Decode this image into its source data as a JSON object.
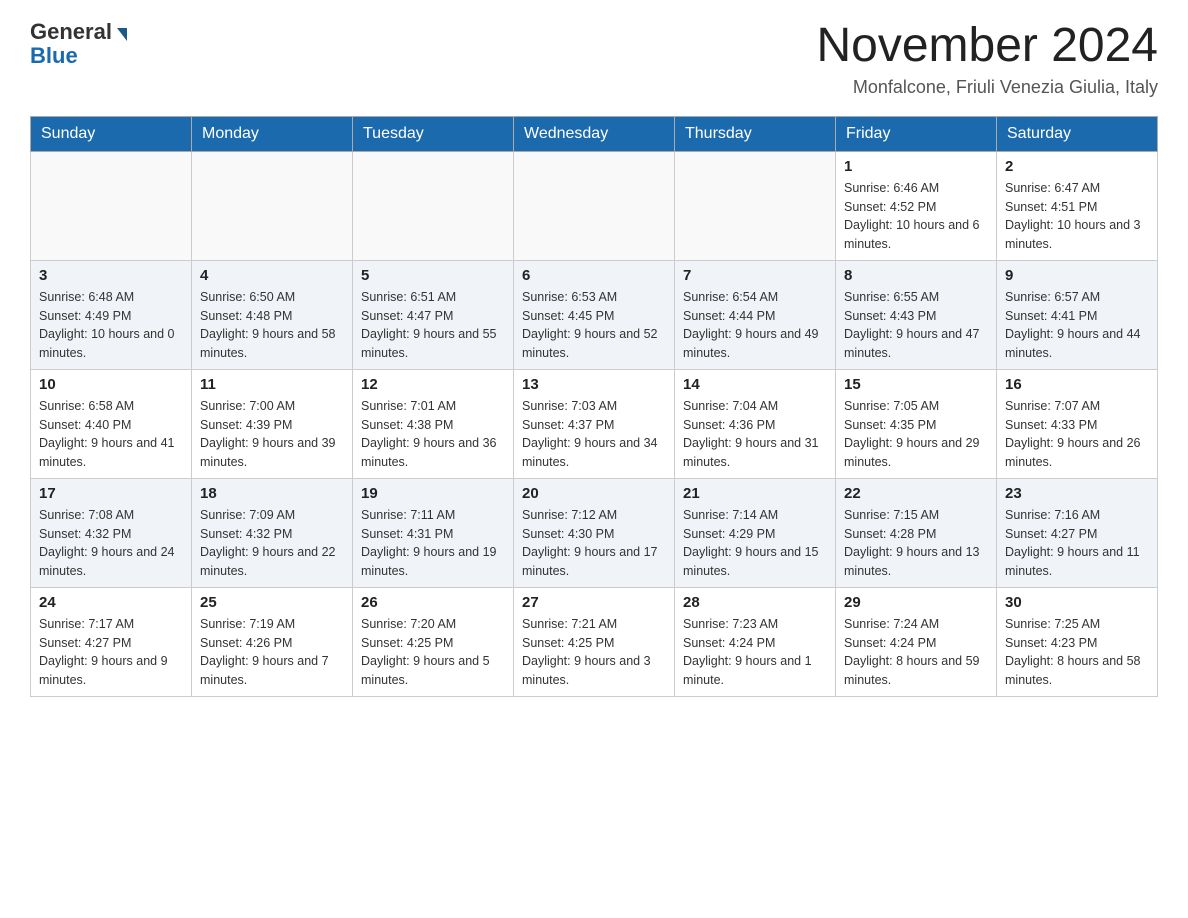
{
  "header": {
    "logo_general": "General",
    "logo_blue": "Blue",
    "month_title": "November 2024",
    "location": "Monfalcone, Friuli Venezia Giulia, Italy"
  },
  "weekdays": [
    "Sunday",
    "Monday",
    "Tuesday",
    "Wednesday",
    "Thursday",
    "Friday",
    "Saturday"
  ],
  "weeks": [
    [
      {
        "day": "",
        "info": ""
      },
      {
        "day": "",
        "info": ""
      },
      {
        "day": "",
        "info": ""
      },
      {
        "day": "",
        "info": ""
      },
      {
        "day": "",
        "info": ""
      },
      {
        "day": "1",
        "info": "Sunrise: 6:46 AM\nSunset: 4:52 PM\nDaylight: 10 hours and 6 minutes."
      },
      {
        "day": "2",
        "info": "Sunrise: 6:47 AM\nSunset: 4:51 PM\nDaylight: 10 hours and 3 minutes."
      }
    ],
    [
      {
        "day": "3",
        "info": "Sunrise: 6:48 AM\nSunset: 4:49 PM\nDaylight: 10 hours and 0 minutes."
      },
      {
        "day": "4",
        "info": "Sunrise: 6:50 AM\nSunset: 4:48 PM\nDaylight: 9 hours and 58 minutes."
      },
      {
        "day": "5",
        "info": "Sunrise: 6:51 AM\nSunset: 4:47 PM\nDaylight: 9 hours and 55 minutes."
      },
      {
        "day": "6",
        "info": "Sunrise: 6:53 AM\nSunset: 4:45 PM\nDaylight: 9 hours and 52 minutes."
      },
      {
        "day": "7",
        "info": "Sunrise: 6:54 AM\nSunset: 4:44 PM\nDaylight: 9 hours and 49 minutes."
      },
      {
        "day": "8",
        "info": "Sunrise: 6:55 AM\nSunset: 4:43 PM\nDaylight: 9 hours and 47 minutes."
      },
      {
        "day": "9",
        "info": "Sunrise: 6:57 AM\nSunset: 4:41 PM\nDaylight: 9 hours and 44 minutes."
      }
    ],
    [
      {
        "day": "10",
        "info": "Sunrise: 6:58 AM\nSunset: 4:40 PM\nDaylight: 9 hours and 41 minutes."
      },
      {
        "day": "11",
        "info": "Sunrise: 7:00 AM\nSunset: 4:39 PM\nDaylight: 9 hours and 39 minutes."
      },
      {
        "day": "12",
        "info": "Sunrise: 7:01 AM\nSunset: 4:38 PM\nDaylight: 9 hours and 36 minutes."
      },
      {
        "day": "13",
        "info": "Sunrise: 7:03 AM\nSunset: 4:37 PM\nDaylight: 9 hours and 34 minutes."
      },
      {
        "day": "14",
        "info": "Sunrise: 7:04 AM\nSunset: 4:36 PM\nDaylight: 9 hours and 31 minutes."
      },
      {
        "day": "15",
        "info": "Sunrise: 7:05 AM\nSunset: 4:35 PM\nDaylight: 9 hours and 29 minutes."
      },
      {
        "day": "16",
        "info": "Sunrise: 7:07 AM\nSunset: 4:33 PM\nDaylight: 9 hours and 26 minutes."
      }
    ],
    [
      {
        "day": "17",
        "info": "Sunrise: 7:08 AM\nSunset: 4:32 PM\nDaylight: 9 hours and 24 minutes."
      },
      {
        "day": "18",
        "info": "Sunrise: 7:09 AM\nSunset: 4:32 PM\nDaylight: 9 hours and 22 minutes."
      },
      {
        "day": "19",
        "info": "Sunrise: 7:11 AM\nSunset: 4:31 PM\nDaylight: 9 hours and 19 minutes."
      },
      {
        "day": "20",
        "info": "Sunrise: 7:12 AM\nSunset: 4:30 PM\nDaylight: 9 hours and 17 minutes."
      },
      {
        "day": "21",
        "info": "Sunrise: 7:14 AM\nSunset: 4:29 PM\nDaylight: 9 hours and 15 minutes."
      },
      {
        "day": "22",
        "info": "Sunrise: 7:15 AM\nSunset: 4:28 PM\nDaylight: 9 hours and 13 minutes."
      },
      {
        "day": "23",
        "info": "Sunrise: 7:16 AM\nSunset: 4:27 PM\nDaylight: 9 hours and 11 minutes."
      }
    ],
    [
      {
        "day": "24",
        "info": "Sunrise: 7:17 AM\nSunset: 4:27 PM\nDaylight: 9 hours and 9 minutes."
      },
      {
        "day": "25",
        "info": "Sunrise: 7:19 AM\nSunset: 4:26 PM\nDaylight: 9 hours and 7 minutes."
      },
      {
        "day": "26",
        "info": "Sunrise: 7:20 AM\nSunset: 4:25 PM\nDaylight: 9 hours and 5 minutes."
      },
      {
        "day": "27",
        "info": "Sunrise: 7:21 AM\nSunset: 4:25 PM\nDaylight: 9 hours and 3 minutes."
      },
      {
        "day": "28",
        "info": "Sunrise: 7:23 AM\nSunset: 4:24 PM\nDaylight: 9 hours and 1 minute."
      },
      {
        "day": "29",
        "info": "Sunrise: 7:24 AM\nSunset: 4:24 PM\nDaylight: 8 hours and 59 minutes."
      },
      {
        "day": "30",
        "info": "Sunrise: 7:25 AM\nSunset: 4:23 PM\nDaylight: 8 hours and 58 minutes."
      }
    ]
  ]
}
